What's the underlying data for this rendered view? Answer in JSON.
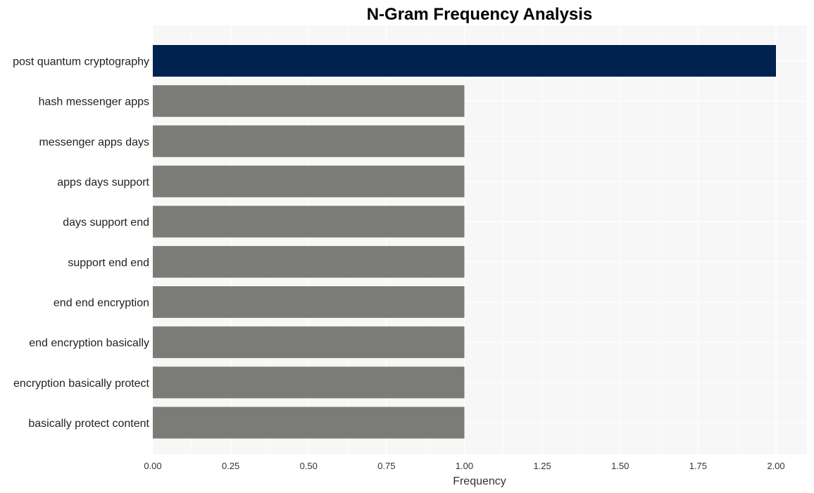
{
  "chart_data": {
    "type": "bar",
    "orientation": "horizontal",
    "title": "N-Gram Frequency Analysis",
    "xlabel": "Frequency",
    "ylabel": "",
    "categories": [
      "post quantum cryptography",
      "hash messenger apps",
      "messenger apps days",
      "apps days support",
      "days support end",
      "support end end",
      "end end encryption",
      "end encryption basically",
      "encryption basically protect",
      "basically protect content"
    ],
    "values": [
      2,
      1,
      1,
      1,
      1,
      1,
      1,
      1,
      1,
      1
    ],
    "xlim": [
      0,
      2.1
    ],
    "xticks": [
      "0.00",
      "0.25",
      "0.50",
      "0.75",
      "1.00",
      "1.25",
      "1.50",
      "1.75",
      "2.00"
    ],
    "grid": true,
    "legend": "none",
    "colors": {
      "highlight": "#00224e",
      "default": "#7b7b77",
      "plot_background": "#f7f7f7",
      "grid": "#ffffff"
    }
  }
}
